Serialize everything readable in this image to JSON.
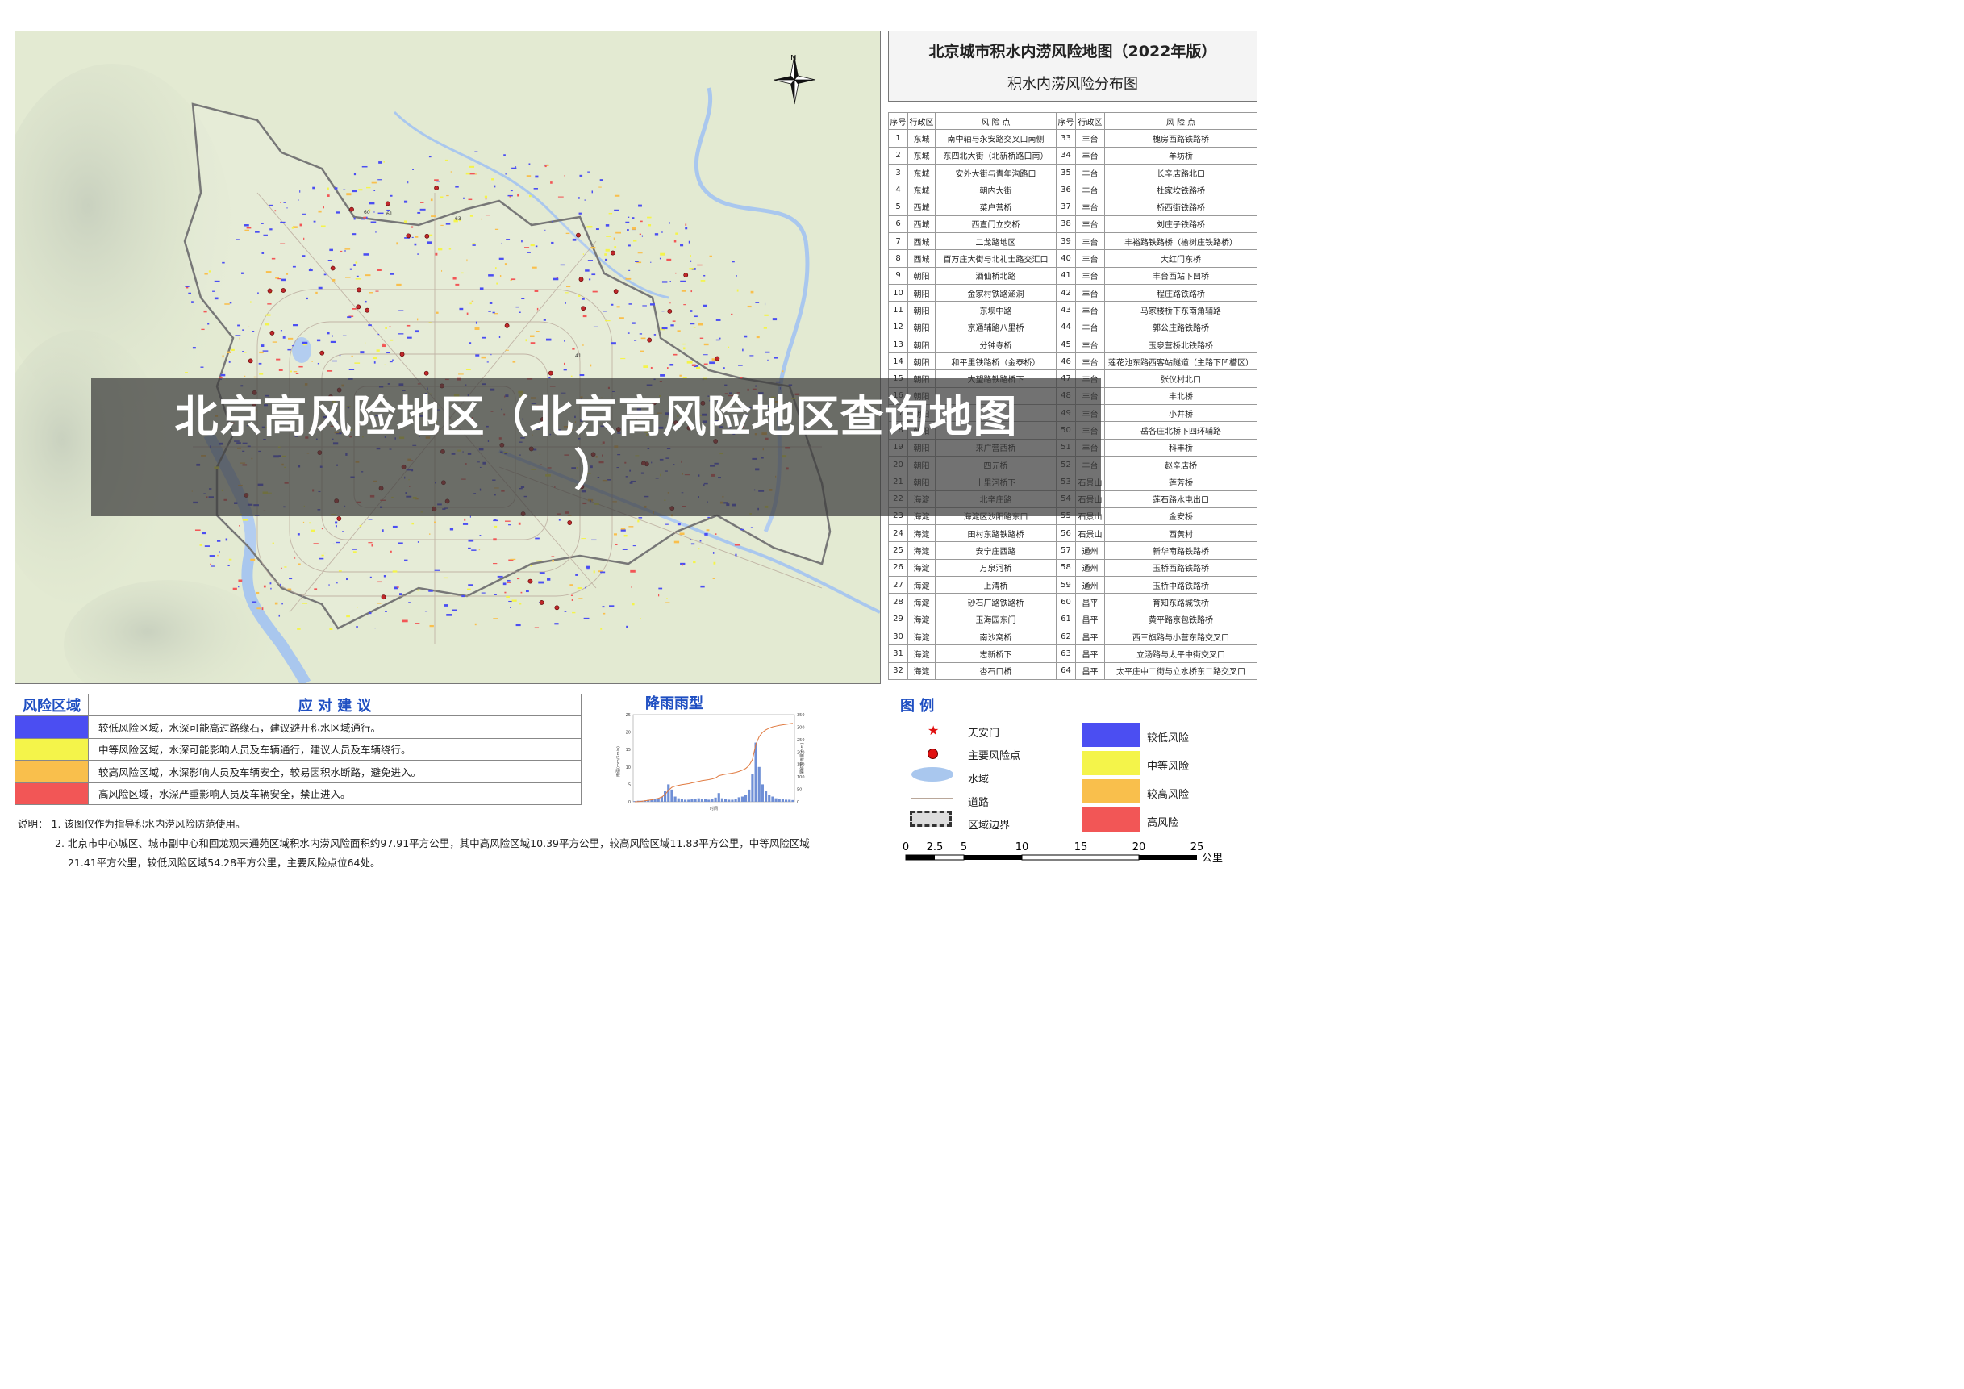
{
  "map": {
    "title": "北京城市积水内涝风险地图（2022年版）",
    "subtitle": "积水内涝风险分布图",
    "north_label": "N",
    "point_labels": [
      "60",
      "61",
      "61",
      "63",
      "41",
      "45"
    ]
  },
  "risk_table": {
    "headers": [
      "序号",
      "行政区",
      "风 险 点",
      "序号",
      "行政区",
      "风 险 点"
    ],
    "rows": [
      [
        "1",
        "东城",
        "南中轴与永安路交叉口南侧",
        "33",
        "丰台",
        "槐房西路铁路桥"
      ],
      [
        "2",
        "东城",
        "东四北大街（北新桥路口南）",
        "34",
        "丰台",
        "羊坊桥"
      ],
      [
        "3",
        "东城",
        "安外大街与青年沟路口",
        "35",
        "丰台",
        "长辛店路北口"
      ],
      [
        "4",
        "东城",
        "朝内大街",
        "36",
        "丰台",
        "杜家坎铁路桥"
      ],
      [
        "5",
        "西城",
        "菜户营桥",
        "37",
        "丰台",
        "桥西街铁路桥"
      ],
      [
        "6",
        "西城",
        "西直门立交桥",
        "38",
        "丰台",
        "刘庄子铁路桥"
      ],
      [
        "7",
        "西城",
        "二龙路地区",
        "39",
        "丰台",
        "丰裕路铁路桥（榆树庄铁路桥）"
      ],
      [
        "8",
        "西城",
        "百万庄大街与北礼士路交汇口",
        "40",
        "丰台",
        "大红门东桥"
      ],
      [
        "9",
        "朝阳",
        "酒仙桥北路",
        "41",
        "丰台",
        "丰台西站下凹桥"
      ],
      [
        "10",
        "朝阳",
        "金家村铁路涵洞",
        "42",
        "丰台",
        "程庄路铁路桥"
      ],
      [
        "11",
        "朝阳",
        "东坝中路",
        "43",
        "丰台",
        "马家楼桥下东南角辅路"
      ],
      [
        "12",
        "朝阳",
        "京通辅路八里桥",
        "44",
        "丰台",
        "郭公庄路铁路桥"
      ],
      [
        "13",
        "朝阳",
        "分钟寺桥",
        "45",
        "丰台",
        "玉泉营桥北铁路桥"
      ],
      [
        "14",
        "朝阳",
        "和平里铁路桥（金泰桥）",
        "46",
        "丰台",
        "莲花池东路西客站隧道（主路下凹槽区）"
      ],
      [
        "15",
        "朝阳",
        "大望路铁路桥下",
        "47",
        "丰台",
        "张仪村北口"
      ],
      [
        "16",
        "朝阳",
        "",
        "48",
        "丰台",
        "丰北桥"
      ],
      [
        "17",
        "朝阳",
        "",
        "49",
        "丰台",
        "小井桥"
      ],
      [
        "18",
        "朝阳",
        "",
        "50",
        "丰台",
        "岳各庄北桥下四环辅路"
      ],
      [
        "19",
        "朝阳",
        "来广营西桥",
        "51",
        "丰台",
        "科丰桥"
      ],
      [
        "20",
        "朝阳",
        "四元桥",
        "52",
        "丰台",
        "赵辛店桥"
      ],
      [
        "21",
        "朝阳",
        "十里河桥下",
        "53",
        "石景山",
        "莲芳桥"
      ],
      [
        "22",
        "海淀",
        "北辛庄路",
        "54",
        "石景山",
        "莲石路水屯出口"
      ],
      [
        "23",
        "海淀",
        "海淀区沙阳路东口",
        "55",
        "石景山",
        "金安桥"
      ],
      [
        "24",
        "海淀",
        "田村东路铁路桥",
        "56",
        "石景山",
        "西黄村"
      ],
      [
        "25",
        "海淀",
        "安宁庄西路",
        "57",
        "通州",
        "新华南路铁路桥"
      ],
      [
        "26",
        "海淀",
        "万泉河桥",
        "58",
        "通州",
        "玉桥西路铁路桥"
      ],
      [
        "27",
        "海淀",
        "上清桥",
        "59",
        "通州",
        "玉桥中路铁路桥"
      ],
      [
        "28",
        "海淀",
        "砂石厂路铁路桥",
        "60",
        "昌平",
        "育知东路城铁桥"
      ],
      [
        "29",
        "海淀",
        "玉海园东门",
        "61",
        "昌平",
        "黄平路京包铁路桥"
      ],
      [
        "30",
        "海淀",
        "南沙窝桥",
        "62",
        "昌平",
        "西三旗路与小营东路交叉口"
      ],
      [
        "31",
        "海淀",
        "志新桥下",
        "63",
        "昌平",
        "立汤路与太平中街交叉口"
      ],
      [
        "32",
        "海淀",
        "杏石口桥",
        "64",
        "昌平",
        "太平庄中二街与立水桥东二路交叉口"
      ]
    ]
  },
  "advice_table": {
    "header_zone": "风险区域",
    "header_advice": "应  对  建  议",
    "rows": [
      {
        "color": "#4b4ef2",
        "text": "较低风险区域，水深可能高过路缘石，建议避开积水区域通行。"
      },
      {
        "color": "#f4f44a",
        "text": "中等风险区域，水深可能影响人员及车辆通行，建议人员及车辆绕行。"
      },
      {
        "color": "#f9bf4c",
        "text": "较高风险区域，水深影响人员及车辆安全，较易因积水断路，避免进入。"
      },
      {
        "color": "#f25656",
        "text": "高风险区域，水深严重影响人员及车辆安全，禁止进入。"
      }
    ]
  },
  "notes": {
    "label": "说明：",
    "line1": "1. 该图仅作为指导积水内涝风险防范使用。",
    "line2": "2. 北京市中心城区、城市副中心和回龙观天通苑区域积水内涝风险面积约97.91平方公里，其中高风险区域10.39平方公里，较高风险区域11.83平方公里，中等风险区域",
    "line3": "21.41平方公里，较低风险区域54.28平方公里，主要风险点位64处。"
  },
  "rain_chart": {
    "title": "降雨雨型",
    "x_axis_label": "时间",
    "y_left_label": "雨强(mm/5min)",
    "y_right_label": "累积降雨量(mm)",
    "y_left_ticks": [
      "0",
      "5",
      "10",
      "15",
      "20",
      "25"
    ],
    "y_right_ticks": [
      "0",
      "50",
      "100",
      "150",
      "200",
      "250",
      "300",
      "350"
    ]
  },
  "chart_data": {
    "type": "bar",
    "title": "降雨雨型",
    "xlabel": "时间",
    "ylabel": "雨强(mm/5min)",
    "y2label": "累积降雨量(mm)",
    "ylim": [
      0,
      25
    ],
    "y2lim": [
      0,
      350
    ],
    "series": [
      {
        "type": "bar",
        "values": [
          0.2,
          0.3,
          0.3,
          0.4,
          0.5,
          0.6,
          0.8,
          1,
          1.5,
          3,
          5,
          3.5,
          1.5,
          1,
          0.8,
          0.6,
          0.6,
          0.7,
          0.9,
          1,
          0.8,
          0.7,
          0.6,
          0.9,
          1.2,
          2.5,
          1,
          0.8,
          0.6,
          0.6,
          0.8,
          1.3,
          1.5,
          2,
          3.5,
          8,
          17,
          10,
          5,
          3,
          2,
          1.5,
          1,
          0.8,
          0.7,
          0.6,
          0.6,
          0.5
        ]
      },
      {
        "type": "line",
        "values": [
          0,
          1,
          2,
          4,
          6,
          8,
          11,
          14,
          19,
          29,
          46,
          58,
          63,
          66,
          69,
          71,
          73,
          76,
          79,
          82,
          85,
          87,
          89,
          92,
          96,
          105,
          108,
          111,
          113,
          115,
          118,
          122,
          127,
          134,
          146,
          170,
          230,
          262,
          279,
          289,
          296,
          301,
          304,
          307,
          309,
          311,
          313,
          315
        ]
      }
    ]
  },
  "legend": {
    "title": "图 例",
    "items": {
      "tiananmen": "天安门",
      "major_point": "主要风险点",
      "water": "水域",
      "road": "道路",
      "boundary": "区域边界",
      "low": "较低风险",
      "medium": "中等风险",
      "high_mid": "较高风险",
      "high": "高风险"
    },
    "colors": {
      "low": "#4b4ef2",
      "medium": "#f4f44a",
      "high_mid": "#f9bf4c",
      "high": "#f25656",
      "water": "#a9c7ee",
      "point": "#e01010"
    }
  },
  "scale": {
    "ticks": [
      "0",
      "2.5",
      "5",
      "10",
      "15",
      "20",
      "25"
    ],
    "unit": "公里"
  },
  "banner": {
    "text_line1": "北京高风险地区（北京高风险地区查询地图",
    "text_line2": "）"
  }
}
